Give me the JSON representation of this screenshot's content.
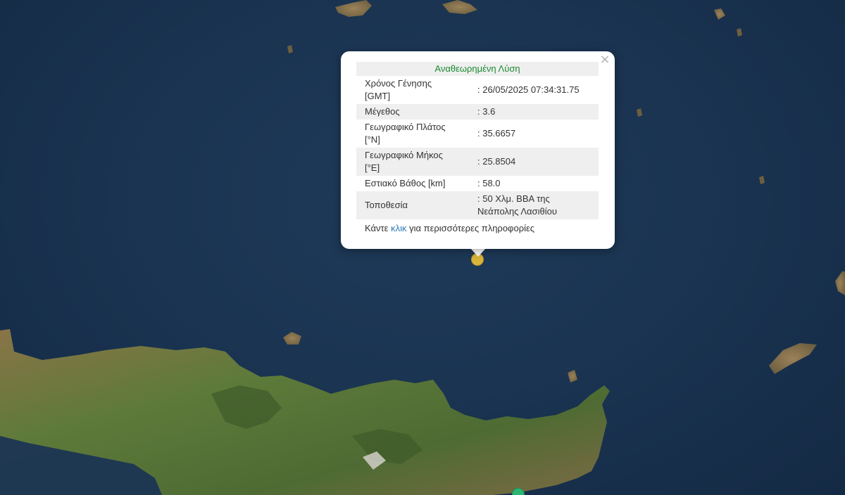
{
  "map": {
    "colors": {
      "sea": "#1a3452",
      "land_green": "#4e6b33",
      "land_brown": "#8a7447",
      "epicenter": "#d9b43a",
      "other_event": "#2bb673"
    }
  },
  "popup": {
    "close_icon": "close-icon",
    "heading": "Αναθεωρημένη Λύση",
    "heading_color": "#1b8a2e",
    "rows": [
      {
        "label": "Χρόνος Γένησης [GMT]",
        "value": ": 26/05/2025 07:34:31.75"
      },
      {
        "label": "Μέγεθος",
        "value": ": 3.6"
      },
      {
        "label": "Γεωγραφικό Πλάτος [°N]",
        "value": ": 35.6657"
      },
      {
        "label": "Γεωγραφικό Μήκος [°E]",
        "value": ": 25.8504"
      },
      {
        "label": "Εστιακό Βάθος [km]",
        "value": ": 58.0"
      },
      {
        "label": "Τοποθεσία",
        "value": ": 50 Χλμ. ΒΒΑ της Νεάπολης Λασιθίου"
      }
    ],
    "more_prefix": "Κάντε ",
    "more_link": "κλικ",
    "more_suffix": " για περισσότερες πληροφορίες"
  }
}
